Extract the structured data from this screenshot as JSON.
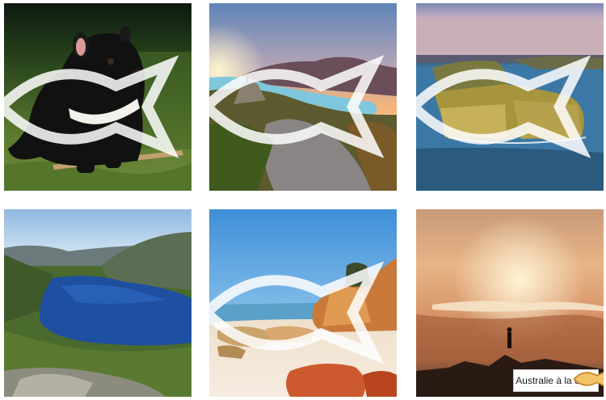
{
  "grid": {
    "tiles": [
      {
        "subject": "tasmanian-devil"
      },
      {
        "subject": "wineglass-bay-sunset"
      },
      {
        "subject": "cape-hauy-cliffs"
      },
      {
        "subject": "dove-lake-cradle-mountain"
      },
      {
        "subject": "bay-of-fires-rocks"
      },
      {
        "subject": "kunanyi-summit-sunrise"
      }
    ]
  },
  "watermark": {
    "icon": "fish-logo-icon"
  },
  "brand": {
    "label": "Australie à la carte",
    "icon": "fish-logo-icon"
  }
}
